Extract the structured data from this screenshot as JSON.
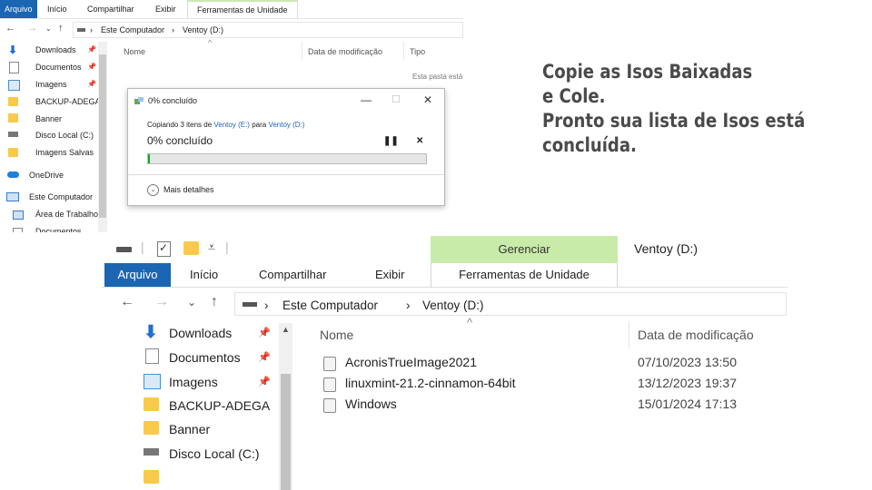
{
  "top_explorer": {
    "ribbon_tabs": [
      "Arquivo",
      "Início",
      "Compartilhar",
      "Exibir",
      "Ferramentas de Unidade"
    ],
    "address": [
      "Este Computador",
      "Ventoy (D:)"
    ],
    "sidebar": [
      "Downloads",
      "Documentos",
      "Imagens",
      "BACKUP-ADEGA",
      "Banner",
      "Disco Local (C:)",
      "Imagens Salvas",
      "OneDrive",
      "Este Computador",
      "Área de Trabalho",
      "Documentos"
    ],
    "columns": [
      "Nome",
      "Data de modificação",
      "Tipo"
    ],
    "empty_text": "Esta pasta está"
  },
  "dialog": {
    "title": "0% concluído",
    "copy_prefix": "Copiando 3 itens de ",
    "source": "Ventoy (E:)",
    "to_word": " para ",
    "destination": "Ventoy (D:)",
    "progress_text": "0% concluído",
    "progress_fraction": 0.005,
    "more_details": "Mais detalhes"
  },
  "note": {
    "line1": "Copie as Isos Baixadas",
    "line2": "e Cole.",
    "line3": "Pronto  sua lista de Isos está",
    "line4": "concluída."
  },
  "bottom_explorer": {
    "manage_label": "Gerenciar",
    "window_title": "Ventoy (D:)",
    "ribbon_tabs": [
      "Arquivo",
      "Início",
      "Compartilhar",
      "Exibir",
      "Ferramentas de Unidade"
    ],
    "address": [
      "Este Computador",
      "Ventoy (D:)"
    ],
    "sidebar": [
      "Downloads",
      "Documentos",
      "Imagens",
      "BACKUP-ADEGA",
      "Banner",
      "Disco Local (C:)"
    ],
    "columns": [
      "Nome",
      "Data de modificação"
    ],
    "files": [
      {
        "name": "AcronisTrueImage2021",
        "date": "07/10/2023 13:50"
      },
      {
        "name": "linuxmint-21.2-cinnamon-64bit",
        "date": "13/12/2023 19:37"
      },
      {
        "name": "Windows",
        "date": "15/01/2024 17:13"
      }
    ]
  }
}
